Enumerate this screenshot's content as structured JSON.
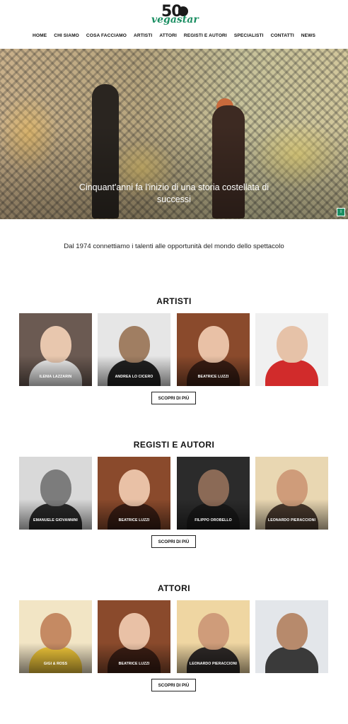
{
  "header": {
    "logo_number": "50",
    "logo_brand": "vegastar",
    "nav": [
      "HOME",
      "CHI SIAMO",
      "COSA FACCIAMO",
      "ARTISTI",
      "ATTORI",
      "REGISTI E AUTORI",
      "SPECIALISTI",
      "CONTATTI",
      "NEWS"
    ]
  },
  "hero": {
    "caption": "Cinquant'anni fa l'inizio di una storia costellata di successi",
    "corner_icon": "info-icon"
  },
  "intro": "Dal 1974 connettiamo i talenti alle opportunità del mondo dello spettacolo",
  "sections": [
    {
      "title": "ARTISTI",
      "button": "SCOPRI DI PIÙ",
      "cards": [
        {
          "name": "ILENIA LAZZARIN",
          "bg": "#6b5a52",
          "face": "#e8c7ae",
          "body": "#f2f2f2"
        },
        {
          "name": "ANDREA LO CICERO",
          "bg": "#e6e6e6",
          "face": "#a07e62",
          "body": "#222222"
        },
        {
          "name": "BEATRICE LUZZI",
          "bg": "#8a4a2c",
          "face": "#e9c1a6",
          "body": "#3b1e14"
        },
        {
          "name": "",
          "bg": "#f0f0f0",
          "face": "#e6c2a8",
          "body": "#d12b2b"
        }
      ]
    },
    {
      "title": "REGISTI E AUTORI",
      "button": "SCOPRI DI PIÙ",
      "cards": [
        {
          "name": "EMANUELE GIOVANNINI",
          "bg": "#d9d9d9",
          "face": "#7c7c7c",
          "body": "#2a2a2a"
        },
        {
          "name": "BEATRICE LUZZI",
          "bg": "#8a4a2c",
          "face": "#e9c1a6",
          "body": "#3b1e14"
        },
        {
          "name": "FILIPPO OROBELLO",
          "bg": "#2b2b2b",
          "face": "#8b6a56",
          "body": "#1a1a1a"
        },
        {
          "name": "LEONARDO PIERACCIONI",
          "bg": "#e9d7b2",
          "face": "#cf9c7a",
          "body": "#4a3a2e"
        }
      ]
    },
    {
      "title": "ATTORI",
      "button": "SCOPRI DI PIÙ",
      "cards": [
        {
          "name": "GIGI & ROSS",
          "bg": "#f2e5c5",
          "face": "#c58a63",
          "body": "#f2c83a"
        },
        {
          "name": "BEATRICE LUZZI",
          "bg": "#8a4a2c",
          "face": "#e9c1a6",
          "body": "#3b1e14"
        },
        {
          "name": "LEONARDO PIERACCIONI",
          "bg": "#efd6a2",
          "face": "#cf9c7a",
          "body": "#2f2a28"
        },
        {
          "name": "",
          "bg": "#e3e6ea",
          "face": "#b78a6c",
          "body": "#3a3a3a"
        }
      ]
    }
  ]
}
